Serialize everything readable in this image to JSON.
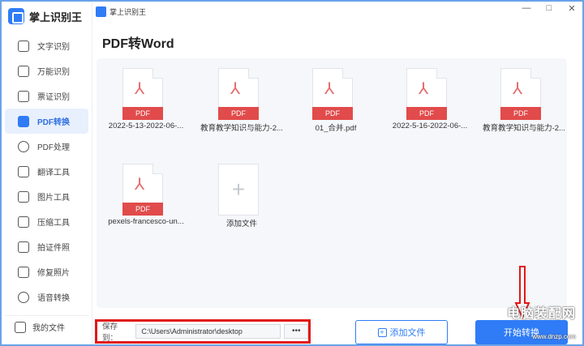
{
  "app": {
    "name": "掌上识别王",
    "window_title": "掌上识别王"
  },
  "window_controls": {
    "minimize": "—",
    "maximize": "□",
    "close": "✕"
  },
  "sidebar": {
    "items": [
      {
        "label": "文字识别",
        "icon": "text-recognition-icon"
      },
      {
        "label": "万能识别",
        "icon": "universal-scan-icon"
      },
      {
        "label": "票证识别",
        "icon": "ticket-icon"
      },
      {
        "label": "PDF转换",
        "icon": "pdf-convert-icon",
        "active": true
      },
      {
        "label": "PDF处理",
        "icon": "pdf-process-icon"
      },
      {
        "label": "翻译工具",
        "icon": "translate-icon"
      },
      {
        "label": "图片工具",
        "icon": "image-tool-icon"
      },
      {
        "label": "压缩工具",
        "icon": "compress-icon"
      },
      {
        "label": "拍证件照",
        "icon": "id-photo-icon"
      },
      {
        "label": "修复照片",
        "icon": "photo-repair-icon"
      },
      {
        "label": "语音转换",
        "icon": "voice-convert-icon"
      }
    ],
    "footer": "我的文件"
  },
  "main": {
    "title": "PDF转Word",
    "files": [
      {
        "name": "2022-5-13-2022-06-...",
        "tag": "PDF"
      },
      {
        "name": "教育教学知识与能力-2...",
        "tag": "PDF"
      },
      {
        "name": "01_合并.pdf",
        "tag": "PDF"
      },
      {
        "name": "2022-5-16-2022-06-...",
        "tag": "PDF"
      },
      {
        "name": "教育教学知识与能力-2...",
        "tag": "PDF"
      },
      {
        "name": "pexels-francesco-un...",
        "tag": "PDF"
      }
    ],
    "add_file_tile": {
      "label": "添加文件",
      "symbol": "+"
    }
  },
  "bottom": {
    "save_label": "保存到：",
    "save_path": "C:\\Users\\Administrator\\desktop",
    "more": "•••",
    "add_button": "添加文件",
    "start_button": "开始转换"
  },
  "watermark": {
    "text": "电脑装配网",
    "url": "www.dnzp.com"
  },
  "colors": {
    "accent": "#2f7cf6",
    "pdf_tag": "#e14b4b",
    "highlight_box": "#e01818",
    "arrow": "#e01818"
  }
}
